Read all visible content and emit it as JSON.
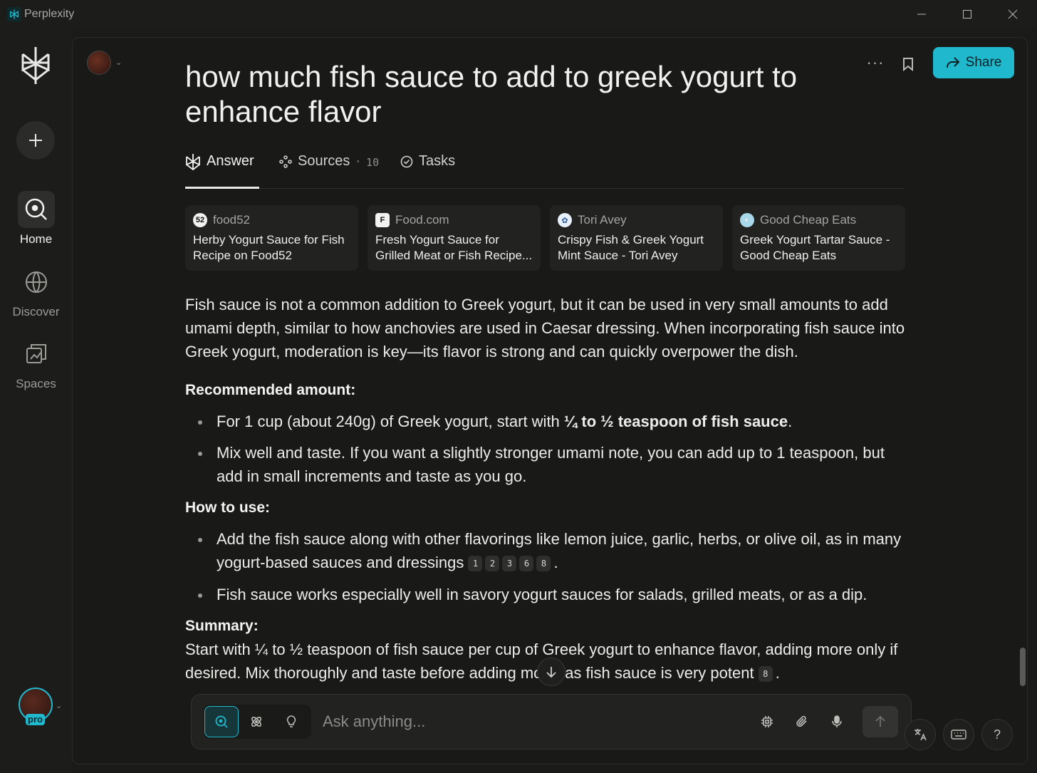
{
  "window": {
    "title": "Perplexity",
    "controls": [
      "minimize",
      "maximize",
      "close"
    ]
  },
  "sidebar": {
    "items": [
      {
        "label": "Home",
        "icon": "search-circle-icon",
        "active": true
      },
      {
        "label": "Discover",
        "icon": "globe-icon",
        "active": false
      },
      {
        "label": "Spaces",
        "icon": "stacked-squares-icon",
        "active": false
      }
    ],
    "pro_badge": "pro"
  },
  "query": {
    "title": "how much fish sauce to add to greek yogurt to enhance flavor"
  },
  "header": {
    "share_label": "Share"
  },
  "tabs": [
    {
      "label": "Answer",
      "active": true
    },
    {
      "label": "Sources",
      "count": "10",
      "separator": "·"
    },
    {
      "label": "Tasks"
    }
  ],
  "sources": [
    {
      "site": "food52",
      "favicon_text": "52",
      "title": "Herby Yogurt Sauce for Fish Recipe on Food52"
    },
    {
      "site": "Food.com",
      "favicon_text": "F",
      "title": "Fresh Yogurt Sauce for Grilled Meat or Fish Recipe..."
    },
    {
      "site": "Tori Avey",
      "favicon_text": "✿",
      "title": "Crispy Fish & Greek Yogurt Mint Sauce - Tori Avey"
    },
    {
      "site": "Good Cheap Eats",
      "favicon_text": "◐",
      "title": "Greek Yogurt Tartar Sauce - Good Cheap Eats"
    }
  ],
  "answer": {
    "intro": "Fish sauce is not a common addition to Greek yogurt, but it can be used in very small amounts to add umami depth, similar to how anchovies are used in Caesar dressing. When incorporating fish sauce into Greek yogurt, moderation is key—its flavor is strong and can quickly overpower the dish.",
    "recommended_heading": "Recommended amount:",
    "rec_item1_pre": "For 1 cup (about 240g) of Greek yogurt, start with ",
    "rec_item1_bold": "¼ to ½ teaspoon of fish sauce",
    "rec_item1_post": ".",
    "rec_item2": "Mix well and taste. If you want a slightly stronger umami note, you can add up to 1 teaspoon, but add in small increments and taste as you go.",
    "howto_heading": "How to use:",
    "howto_item1": "Add the fish sauce along with other flavorings like lemon juice, garlic, herbs, or olive oil, as in many yogurt-based sauces and dressings",
    "howto_item1_citations": [
      "1",
      "2",
      "3",
      "6",
      "8"
    ],
    "howto_item1_end": ".",
    "howto_item2": "Fish sauce works especially well in savory yogurt sauces for salads, grilled meats, or as a dip.",
    "summary_heading": "Summary:",
    "summary_text": "Start with ¼ to ½ teaspoon of fish sauce per cup of Greek yogurt to enhance flavor, adding more only if desired. Mix thoroughly and taste before adding more, as fish sauce is very potent",
    "summary_citation": "8",
    "summary_end": "."
  },
  "askbox": {
    "placeholder": "Ask anything...",
    "modes": [
      "search",
      "research",
      "labs"
    ]
  },
  "colors": {
    "accent": "#20b8cd",
    "background": "#191918",
    "sidebar": "#1c1c1b",
    "card": "#222221"
  }
}
